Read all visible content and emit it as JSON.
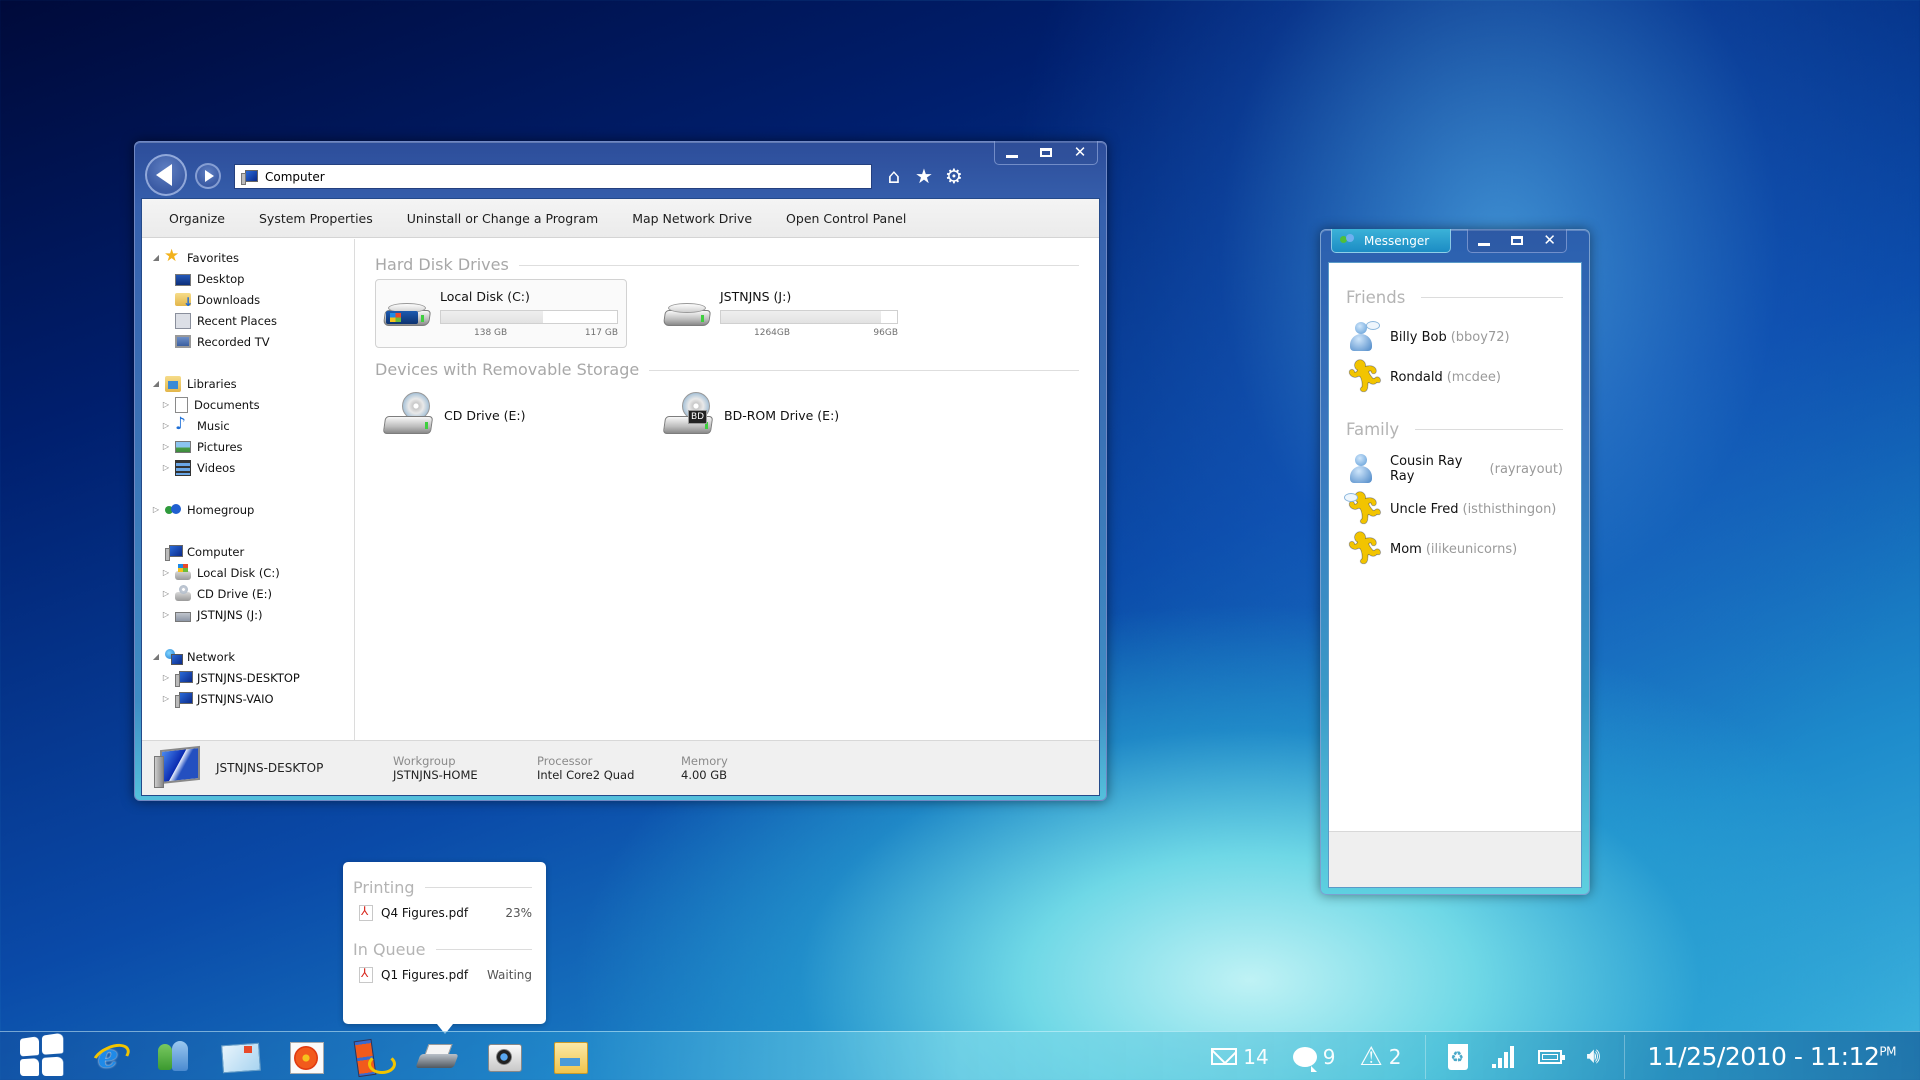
{
  "explorer": {
    "address": "Computer",
    "address_icon": "computer-icon",
    "toolbar_icons": [
      "home-icon",
      "favorites-star-icon",
      "settings-gear-icon"
    ],
    "commands": [
      "Organize",
      "System Properties",
      "Uninstall or Change a Program",
      "Map Network Drive",
      "Open Control Panel"
    ],
    "nav": {
      "favorites": {
        "label": "Favorites",
        "expanded": true,
        "items": [
          "Desktop",
          "Downloads",
          "Recent Places",
          "Recorded TV"
        ]
      },
      "libraries": {
        "label": "Libraries",
        "expanded": true,
        "items": [
          "Documents",
          "Music",
          "Pictures",
          "Videos"
        ]
      },
      "homegroup": {
        "label": "Homegroup",
        "expanded": false
      },
      "computer": {
        "label": "Computer",
        "items": [
          "Local Disk (C:)",
          "CD Drive (E:)",
          "JSTNJNS (J:)"
        ]
      },
      "network": {
        "label": "Network",
        "expanded": true,
        "items": [
          "JSTNJNS-DESKTOP",
          "JSTNJNS-VAIO"
        ]
      }
    },
    "groups": {
      "hard_disks": {
        "title": "Hard Disk Drives",
        "drives": [
          {
            "name": "Local Disk (C:)",
            "used_label": "138 GB",
            "free_label": "117 GB",
            "used_fraction": 0.58,
            "selected": true
          },
          {
            "name": "JSTNJNS (J:)",
            "used_label": "1264GB",
            "free_label": "96GB",
            "used_fraction": 0.91,
            "selected": false
          }
        ]
      },
      "removable": {
        "title": "Devices with Removable Storage",
        "drives": [
          {
            "name": "CD Drive (E:)"
          },
          {
            "name": "BD-ROM Drive (E:)",
            "badge": "BD"
          }
        ]
      }
    },
    "details": {
      "computer_name": "JSTNJNS-DESKTOP",
      "fields": [
        {
          "key": "Workgroup",
          "value": "JSTNJNS-HOME"
        },
        {
          "key": "Processor",
          "value": "Intel Core2 Quad"
        },
        {
          "key": "Memory",
          "value": "4.00 GB"
        }
      ]
    }
  },
  "messenger": {
    "title": "Messenger",
    "groups": [
      {
        "title": "Friends",
        "contacts": [
          {
            "name": "Billy Bob",
            "handle": "(bboy72)",
            "avatar": "person-chat"
          },
          {
            "name": "Rondald",
            "handle": "(mcdee)",
            "avatar": "runner"
          }
        ]
      },
      {
        "title": "Family",
        "contacts": [
          {
            "name": "Cousin Ray Ray",
            "handle": "(rayrayout)",
            "avatar": "person"
          },
          {
            "name": "Uncle Fred",
            "handle": "(isthisthingon)",
            "avatar": "runner-chat"
          },
          {
            "name": "Mom",
            "handle": "(ilikeunicorns)",
            "avatar": "runner"
          }
        ]
      }
    ]
  },
  "print_queue": {
    "printing_title": "Printing",
    "printing": [
      {
        "file": "Q4 Figures.pdf",
        "status": "23%"
      }
    ],
    "queue_title": "In Queue",
    "queue": [
      {
        "file": "Q1 Figures.pdf",
        "status": "Waiting"
      }
    ]
  },
  "taskbar": {
    "pinned": [
      "internet-explorer",
      "messenger",
      "mail",
      "photo-gallery",
      "movie-maker",
      "printer",
      "camera",
      "file-explorer"
    ],
    "tray": {
      "mail_count": "14",
      "message_count": "9",
      "alert_count": "2",
      "date": "11/25/2010",
      "separator": " - ",
      "time": "11:12",
      "ampm": "PM"
    }
  }
}
